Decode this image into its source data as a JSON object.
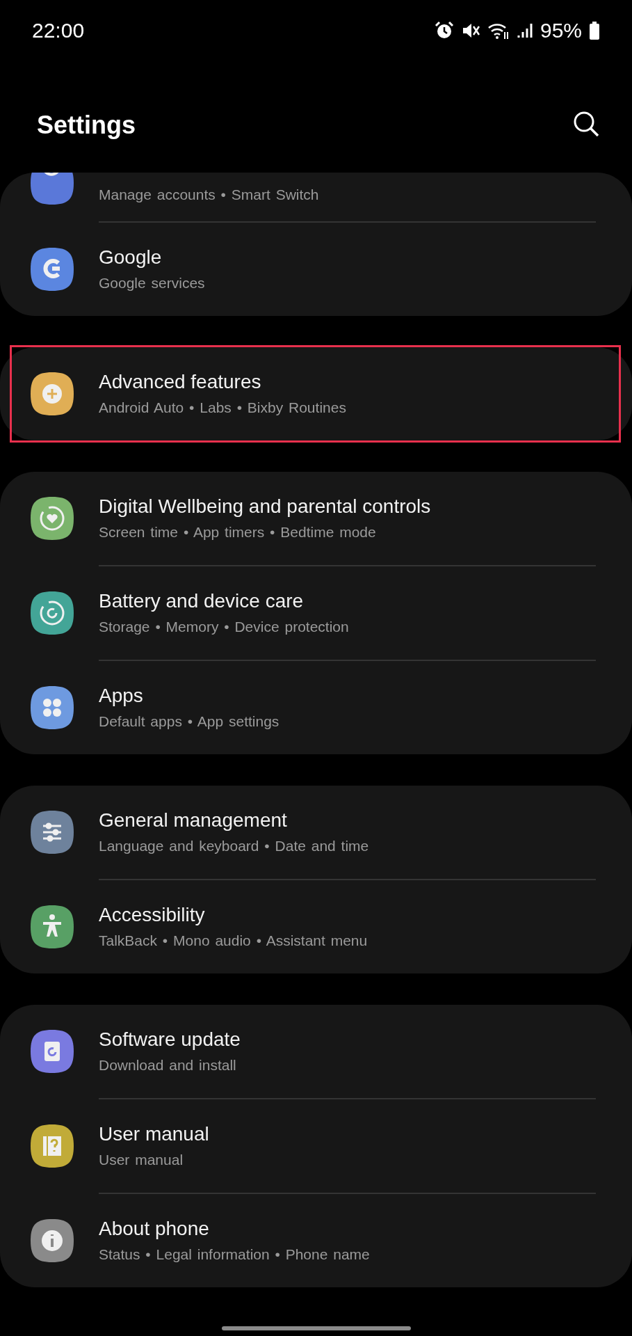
{
  "status_bar": {
    "time": "22:00",
    "battery": "95%"
  },
  "header": {
    "title": "Settings"
  },
  "groups": [
    {
      "highlighted": false,
      "items": [
        {
          "kind": "clipped",
          "subtitle": "Manage accounts • Smart Switch"
        },
        {
          "kind": "full",
          "title": "Google",
          "subtitle": "Google services"
        }
      ]
    },
    {
      "highlighted": true,
      "items": [
        {
          "kind": "full",
          "title": "Advanced features",
          "subtitle": "Android Auto • Labs • Bixby Routines"
        }
      ]
    },
    {
      "highlighted": false,
      "items": [
        {
          "kind": "full",
          "title": "Digital Wellbeing and parental controls",
          "subtitle": "Screen time • App timers • Bedtime mode"
        },
        {
          "kind": "full",
          "title": "Battery and device care",
          "subtitle": "Storage • Memory • Device protection"
        },
        {
          "kind": "full",
          "title": "Apps",
          "subtitle": "Default apps • App settings"
        }
      ]
    },
    {
      "highlighted": false,
      "items": [
        {
          "kind": "full",
          "title": "General management",
          "subtitle": "Language and keyboard • Date and time"
        },
        {
          "kind": "full",
          "title": "Accessibility",
          "subtitle": "TalkBack • Mono audio • Assistant menu"
        }
      ]
    },
    {
      "highlighted": false,
      "items": [
        {
          "kind": "full",
          "title": "Software update",
          "subtitle": "Download and install"
        },
        {
          "kind": "full",
          "title": "User manual",
          "subtitle": "User manual"
        },
        {
          "kind": "full",
          "title": "About phone",
          "subtitle": "Status • Legal information • Phone name"
        }
      ]
    }
  ]
}
